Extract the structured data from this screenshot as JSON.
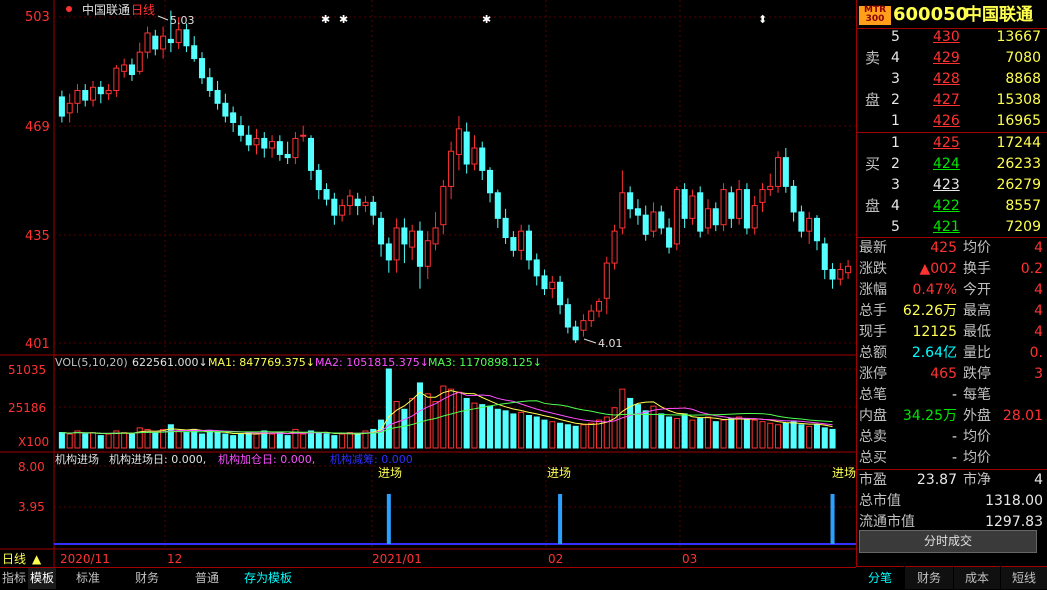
{
  "chart_header": {
    "stock_name": "中国联通",
    "period": "日线"
  },
  "price_axis": [
    "503",
    "469",
    "435",
    "401"
  ],
  "high_label": "5.03",
  "low_label": "4.01",
  "vol_header": {
    "label": "VOL(5,10,20)",
    "vol": "622561.000↓",
    "ma1": "MA1: 847769.375↓",
    "ma2": "MA2: 1051815.375↓",
    "ma3": "MA3: 1170898.125↓"
  },
  "vol_axis": [
    "51035",
    "25186",
    "X100"
  ],
  "ind_header": {
    "name": "机构进场",
    "a": "机构进场日: 0.000,",
    "b": "机构加仓日: 0.000,",
    "c": "机构减筹: 0.000"
  },
  "ind_axis": [
    "8.00",
    "3.95"
  ],
  "signals": [
    "进场",
    "进场",
    "进场"
  ],
  "date_axis": {
    "period": "日线",
    "d1": "2020/11",
    "d2": "12",
    "d3": "2021/01",
    "d4": "02",
    "d5": "03"
  },
  "bottom_tabs": [
    "指标",
    "模板",
    "标准",
    "财务",
    "普通",
    "存为模板"
  ],
  "quote": {
    "badge": "MTR 300",
    "code": "600050",
    "name": "中国联通",
    "sell_label": [
      "卖",
      "盘"
    ],
    "buy_label": [
      "买",
      "盘"
    ],
    "sells": [
      {
        "lvl": "5",
        "price": "430",
        "vol": "13667"
      },
      {
        "lvl": "4",
        "price": "429",
        "vol": "7080"
      },
      {
        "lvl": "3",
        "price": "428",
        "vol": "8868"
      },
      {
        "lvl": "2",
        "price": "427",
        "vol": "15308"
      },
      {
        "lvl": "1",
        "price": "426",
        "vol": "16965"
      }
    ],
    "buys": [
      {
        "lvl": "1",
        "price": "425",
        "vol": "17244"
      },
      {
        "lvl": "2",
        "price": "424",
        "vol": "26233"
      },
      {
        "lvl": "3",
        "price": "423",
        "vol": "26279"
      },
      {
        "lvl": "4",
        "price": "422",
        "vol": "8557"
      },
      {
        "lvl": "5",
        "price": "421",
        "vol": "7209"
      }
    ],
    "stats": [
      {
        "k1": "最新",
        "v1": "425",
        "k2": "均价",
        "v2": "4"
      },
      {
        "k1": "涨跌",
        "v1": "▲002",
        "k2": "换手",
        "v2": "0.2"
      },
      {
        "k1": "涨幅",
        "v1": "0.47%",
        "k2": "今开",
        "v2": "4"
      },
      {
        "k1": "总手",
        "v1": "62.26万",
        "k2": "最高",
        "v2": "4"
      },
      {
        "k1": "现手",
        "v1": "12125",
        "k2": "最低",
        "v2": "4"
      },
      {
        "k1": "总额",
        "v1": "2.64亿",
        "k2": "量比",
        "v2": "0."
      },
      {
        "k1": "涨停",
        "v1": "465",
        "k2": "跌停",
        "v2": "3"
      },
      {
        "k1": "总笔",
        "v1": "-",
        "k2": "每笔",
        "v2": ""
      },
      {
        "k1": "内盘",
        "v1": "34.25万",
        "k2": "外盘",
        "v2": "28.01"
      },
      {
        "k1": "总卖",
        "v1": "-",
        "k2": "均价",
        "v2": ""
      },
      {
        "k1": "总买",
        "v1": "-",
        "k2": "均价",
        "v2": ""
      }
    ],
    "extra": [
      {
        "k": "市盈",
        "v": "23.87",
        "k2": "市净",
        "v2": "4"
      },
      {
        "k": "总市值",
        "v": "1318.00"
      },
      {
        "k": "流通市值",
        "v": "1297.83"
      }
    ],
    "btn": "分时成交",
    "tabs": [
      "分笔",
      "财务",
      "成本",
      "短线"
    ]
  },
  "chart_data": {
    "type": "candlestick",
    "ylim": [
      399,
      506
    ],
    "candles": [
      [
        478,
        472,
        480,
        470
      ],
      [
        473,
        476,
        479,
        470
      ],
      [
        476,
        480,
        482,
        473
      ],
      [
        480,
        477,
        482,
        475
      ],
      [
        477,
        481,
        483,
        475
      ],
      [
        481,
        479,
        483,
        476
      ],
      [
        479,
        480,
        482,
        477
      ],
      [
        480,
        487,
        488,
        478
      ],
      [
        486,
        488,
        490,
        484
      ],
      [
        488,
        485,
        490,
        483
      ],
      [
        486,
        492,
        495,
        485
      ],
      [
        492,
        498,
        500,
        490
      ],
      [
        497,
        493,
        499,
        491
      ],
      [
        493,
        497,
        500,
        490
      ],
      [
        496,
        495,
        505,
        492
      ],
      [
        495,
        499,
        503,
        493
      ],
      [
        499,
        494,
        501,
        492
      ],
      [
        494,
        490,
        497,
        489
      ],
      [
        490,
        484,
        492,
        482
      ],
      [
        484,
        480,
        487,
        478
      ],
      [
        480,
        476,
        483,
        474
      ],
      [
        476,
        472,
        479,
        470
      ],
      [
        473,
        470,
        475,
        467
      ],
      [
        469,
        466,
        472,
        464
      ],
      [
        466,
        463,
        469,
        461
      ],
      [
        463,
        465,
        468,
        460
      ],
      [
        465,
        462,
        467,
        459
      ],
      [
        462,
        464,
        466,
        459
      ],
      [
        464,
        460,
        466,
        458
      ],
      [
        460,
        459,
        464,
        457
      ],
      [
        459,
        465,
        467,
        457
      ],
      [
        466,
        466,
        469,
        464
      ],
      [
        465,
        455,
        466,
        452
      ],
      [
        455,
        449,
        457,
        446
      ],
      [
        449,
        446,
        451,
        444
      ],
      [
        446,
        441,
        448,
        438
      ],
      [
        441,
        444,
        446,
        439
      ],
      [
        444,
        447,
        449,
        441
      ],
      [
        446,
        444,
        448,
        441
      ],
      [
        444,
        445,
        447,
        442
      ],
      [
        445,
        441,
        447,
        438
      ],
      [
        440,
        432,
        442,
        428
      ],
      [
        432,
        427,
        434,
        423
      ],
      [
        427,
        437,
        440,
        423
      ],
      [
        437,
        432,
        440,
        426
      ],
      [
        431,
        436,
        438,
        427
      ],
      [
        436,
        425,
        439,
        418
      ],
      [
        425,
        433,
        436,
        421
      ],
      [
        432,
        437,
        442,
        430
      ],
      [
        438,
        450,
        452,
        435
      ],
      [
        450,
        461,
        464,
        446
      ],
      [
        460,
        468,
        472,
        455
      ],
      [
        467,
        457,
        470,
        454
      ],
      [
        457,
        462,
        466,
        455
      ],
      [
        462,
        455,
        464,
        452
      ],
      [
        455,
        448,
        456,
        445
      ],
      [
        448,
        440,
        449,
        437
      ],
      [
        440,
        434,
        443,
        432
      ],
      [
        434,
        430,
        436,
        428
      ],
      [
        430,
        436,
        438,
        427
      ],
      [
        436,
        427,
        438,
        424
      ],
      [
        427,
        422,
        429,
        419
      ],
      [
        422,
        418,
        424,
        416
      ],
      [
        418,
        420,
        422,
        415
      ],
      [
        420,
        413,
        422,
        410
      ],
      [
        413,
        406,
        415,
        404
      ],
      [
        406,
        402,
        408,
        401
      ],
      [
        405,
        408,
        410,
        403
      ],
      [
        408,
        411,
        413,
        406
      ],
      [
        411,
        414,
        415,
        409
      ],
      [
        415,
        426,
        428,
        410
      ],
      [
        426,
        436,
        438,
        424
      ],
      [
        437,
        448,
        455,
        435
      ],
      [
        448,
        443,
        450,
        440
      ],
      [
        443,
        441,
        446,
        438
      ],
      [
        441,
        435,
        444,
        433
      ],
      [
        436,
        442,
        445,
        434
      ],
      [
        442,
        437,
        444,
        435
      ],
      [
        437,
        431,
        440,
        429
      ],
      [
        432,
        449,
        450,
        430
      ],
      [
        449,
        440,
        451,
        437
      ],
      [
        440,
        447,
        449,
        438
      ],
      [
        448,
        436,
        450,
        434
      ],
      [
        437,
        443,
        446,
        435
      ],
      [
        443,
        438,
        445,
        436
      ],
      [
        438,
        449,
        451,
        436
      ],
      [
        448,
        440,
        450,
        437
      ],
      [
        440,
        449,
        452,
        438
      ],
      [
        449,
        437,
        451,
        435
      ],
      [
        437,
        444,
        447,
        435
      ],
      [
        445,
        449,
        451,
        442
      ],
      [
        449,
        450,
        454,
        447
      ],
      [
        450,
        459,
        461,
        448
      ],
      [
        459,
        450,
        462,
        448
      ],
      [
        450,
        442,
        452,
        439
      ],
      [
        442,
        436,
        444,
        434
      ],
      [
        436,
        440,
        442,
        432
      ],
      [
        440,
        433,
        441,
        430
      ],
      [
        432,
        424,
        434,
        421
      ],
      [
        424,
        421,
        426,
        418
      ],
      [
        421,
        424,
        426,
        419
      ],
      [
        423,
        425,
        427,
        421
      ]
    ],
    "volume": [
      10,
      9,
      11,
      9,
      10,
      8,
      9,
      11,
      10,
      9,
      13,
      12,
      10,
      12,
      15,
      11,
      10,
      12,
      9,
      11,
      10,
      9,
      8,
      9,
      10,
      9,
      11,
      9,
      10,
      8,
      12,
      9,
      11,
      10,
      9,
      8,
      9,
      10,
      9,
      11,
      12,
      18,
      51,
      30,
      25,
      32,
      42,
      35,
      30,
      40,
      38,
      36,
      32,
      29,
      28,
      27,
      25,
      24,
      22,
      23,
      21,
      20,
      18,
      17,
      16,
      15,
      14,
      15,
      16,
      18,
      20,
      26,
      38,
      32,
      28,
      24,
      27,
      22,
      20,
      19,
      22,
      18,
      19,
      20,
      17,
      18,
      19,
      20,
      19,
      18,
      17,
      16,
      15,
      16,
      17,
      15,
      14,
      15,
      13,
      12
    ],
    "signal_positions": [
      42,
      64,
      99
    ]
  }
}
